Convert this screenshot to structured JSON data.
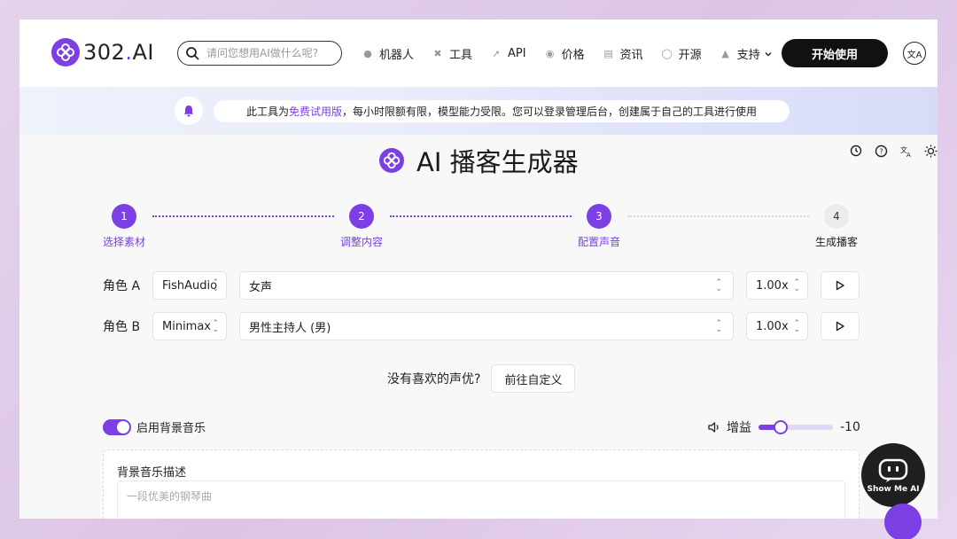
{
  "header": {
    "logo": "302.AI",
    "search_placeholder": "请问您想用AI做什么呢?",
    "nav": [
      {
        "label": "机器人",
        "icon": "robot-icon"
      },
      {
        "label": "工具",
        "icon": "tools-icon"
      },
      {
        "label": "API",
        "icon": "api-icon"
      },
      {
        "label": "价格",
        "icon": "price-icon"
      },
      {
        "label": "资讯",
        "icon": "news-icon"
      },
      {
        "label": "开源",
        "icon": "github-icon"
      },
      {
        "label": "支持",
        "icon": "thumbs-up-icon"
      }
    ],
    "start_button": "开始使用",
    "lang_icon": "translate-icon"
  },
  "banner": {
    "prefix": "此工具为",
    "highlight": "免费试用版",
    "suffix": "，每小时限额有限，模型能力受限。您可以登录管理后台，创建属于自己的工具进行使用",
    "accent": "#7b3fe4"
  },
  "title": "AI 播客生成器",
  "steps": [
    {
      "num": "1",
      "label": "选择素材",
      "state": "done"
    },
    {
      "num": "2",
      "label": "调整内容",
      "state": "done"
    },
    {
      "num": "3",
      "label": "配置声音",
      "state": "current"
    },
    {
      "num": "4",
      "label": "生成播客",
      "state": "pending"
    }
  ],
  "voices": [
    {
      "role": "角色 A",
      "provider": "FishAudio",
      "voice": "女声",
      "speed": "1.00x"
    },
    {
      "role": "角色 B",
      "provider": "Minimax",
      "voice": "男性主持人 (男)",
      "speed": "1.00x"
    }
  ],
  "custom": {
    "question": "没有喜欢的声优?",
    "button": "前往自定义"
  },
  "bgm": {
    "toggle_label": "启用背景音乐",
    "enabled": true,
    "gain_label": "增益",
    "gain_value": "-10",
    "gain_fraction": 0.3,
    "desc_label": "背景音乐描述",
    "desc_placeholder": "一段优美的钢琴曲"
  },
  "assistant": {
    "caption": "Show Me AI"
  }
}
